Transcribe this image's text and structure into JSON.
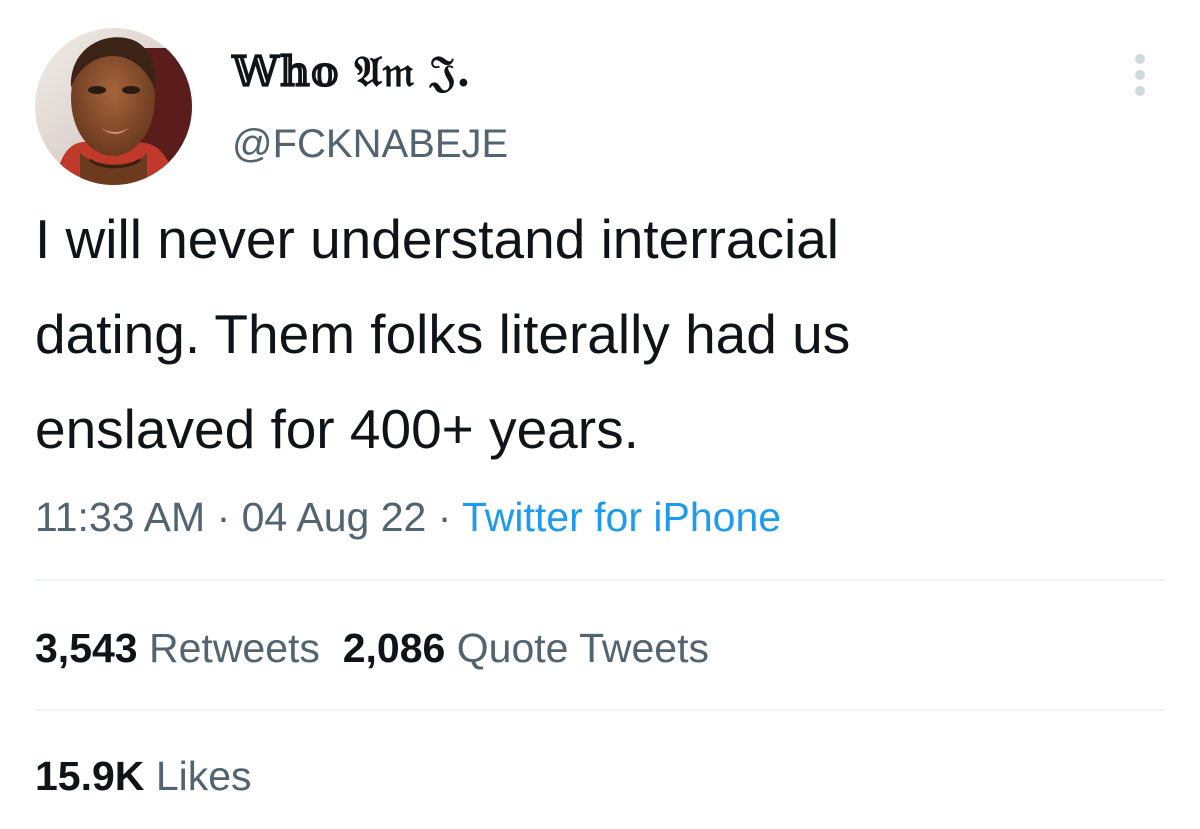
{
  "author": {
    "display_name": "𝕎𝕙𝕠 𝔄𝔪 𝔍.",
    "handle": "@FCKNABEJE"
  },
  "tweet": {
    "lines": [
      "I will never understand interracial",
      "dating. Them folks literally had us",
      "enslaved for 400+ years."
    ],
    "time": "11:33 AM",
    "separator": " · ",
    "date": "04 Aug 22",
    "source": "Twitter for iPhone"
  },
  "stats": {
    "retweets_count": "3,543",
    "retweets_label": "Retweets",
    "quotes_count": "2,086",
    "quotes_label": "Quote Tweets",
    "likes_count": "15.9K",
    "likes_label": "Likes"
  },
  "icons": {
    "more": "more-vertical-icon"
  },
  "colors": {
    "text_primary": "#0f1419",
    "text_secondary": "#536471",
    "link": "#1d9bf0",
    "divider": "#eff3f4"
  }
}
